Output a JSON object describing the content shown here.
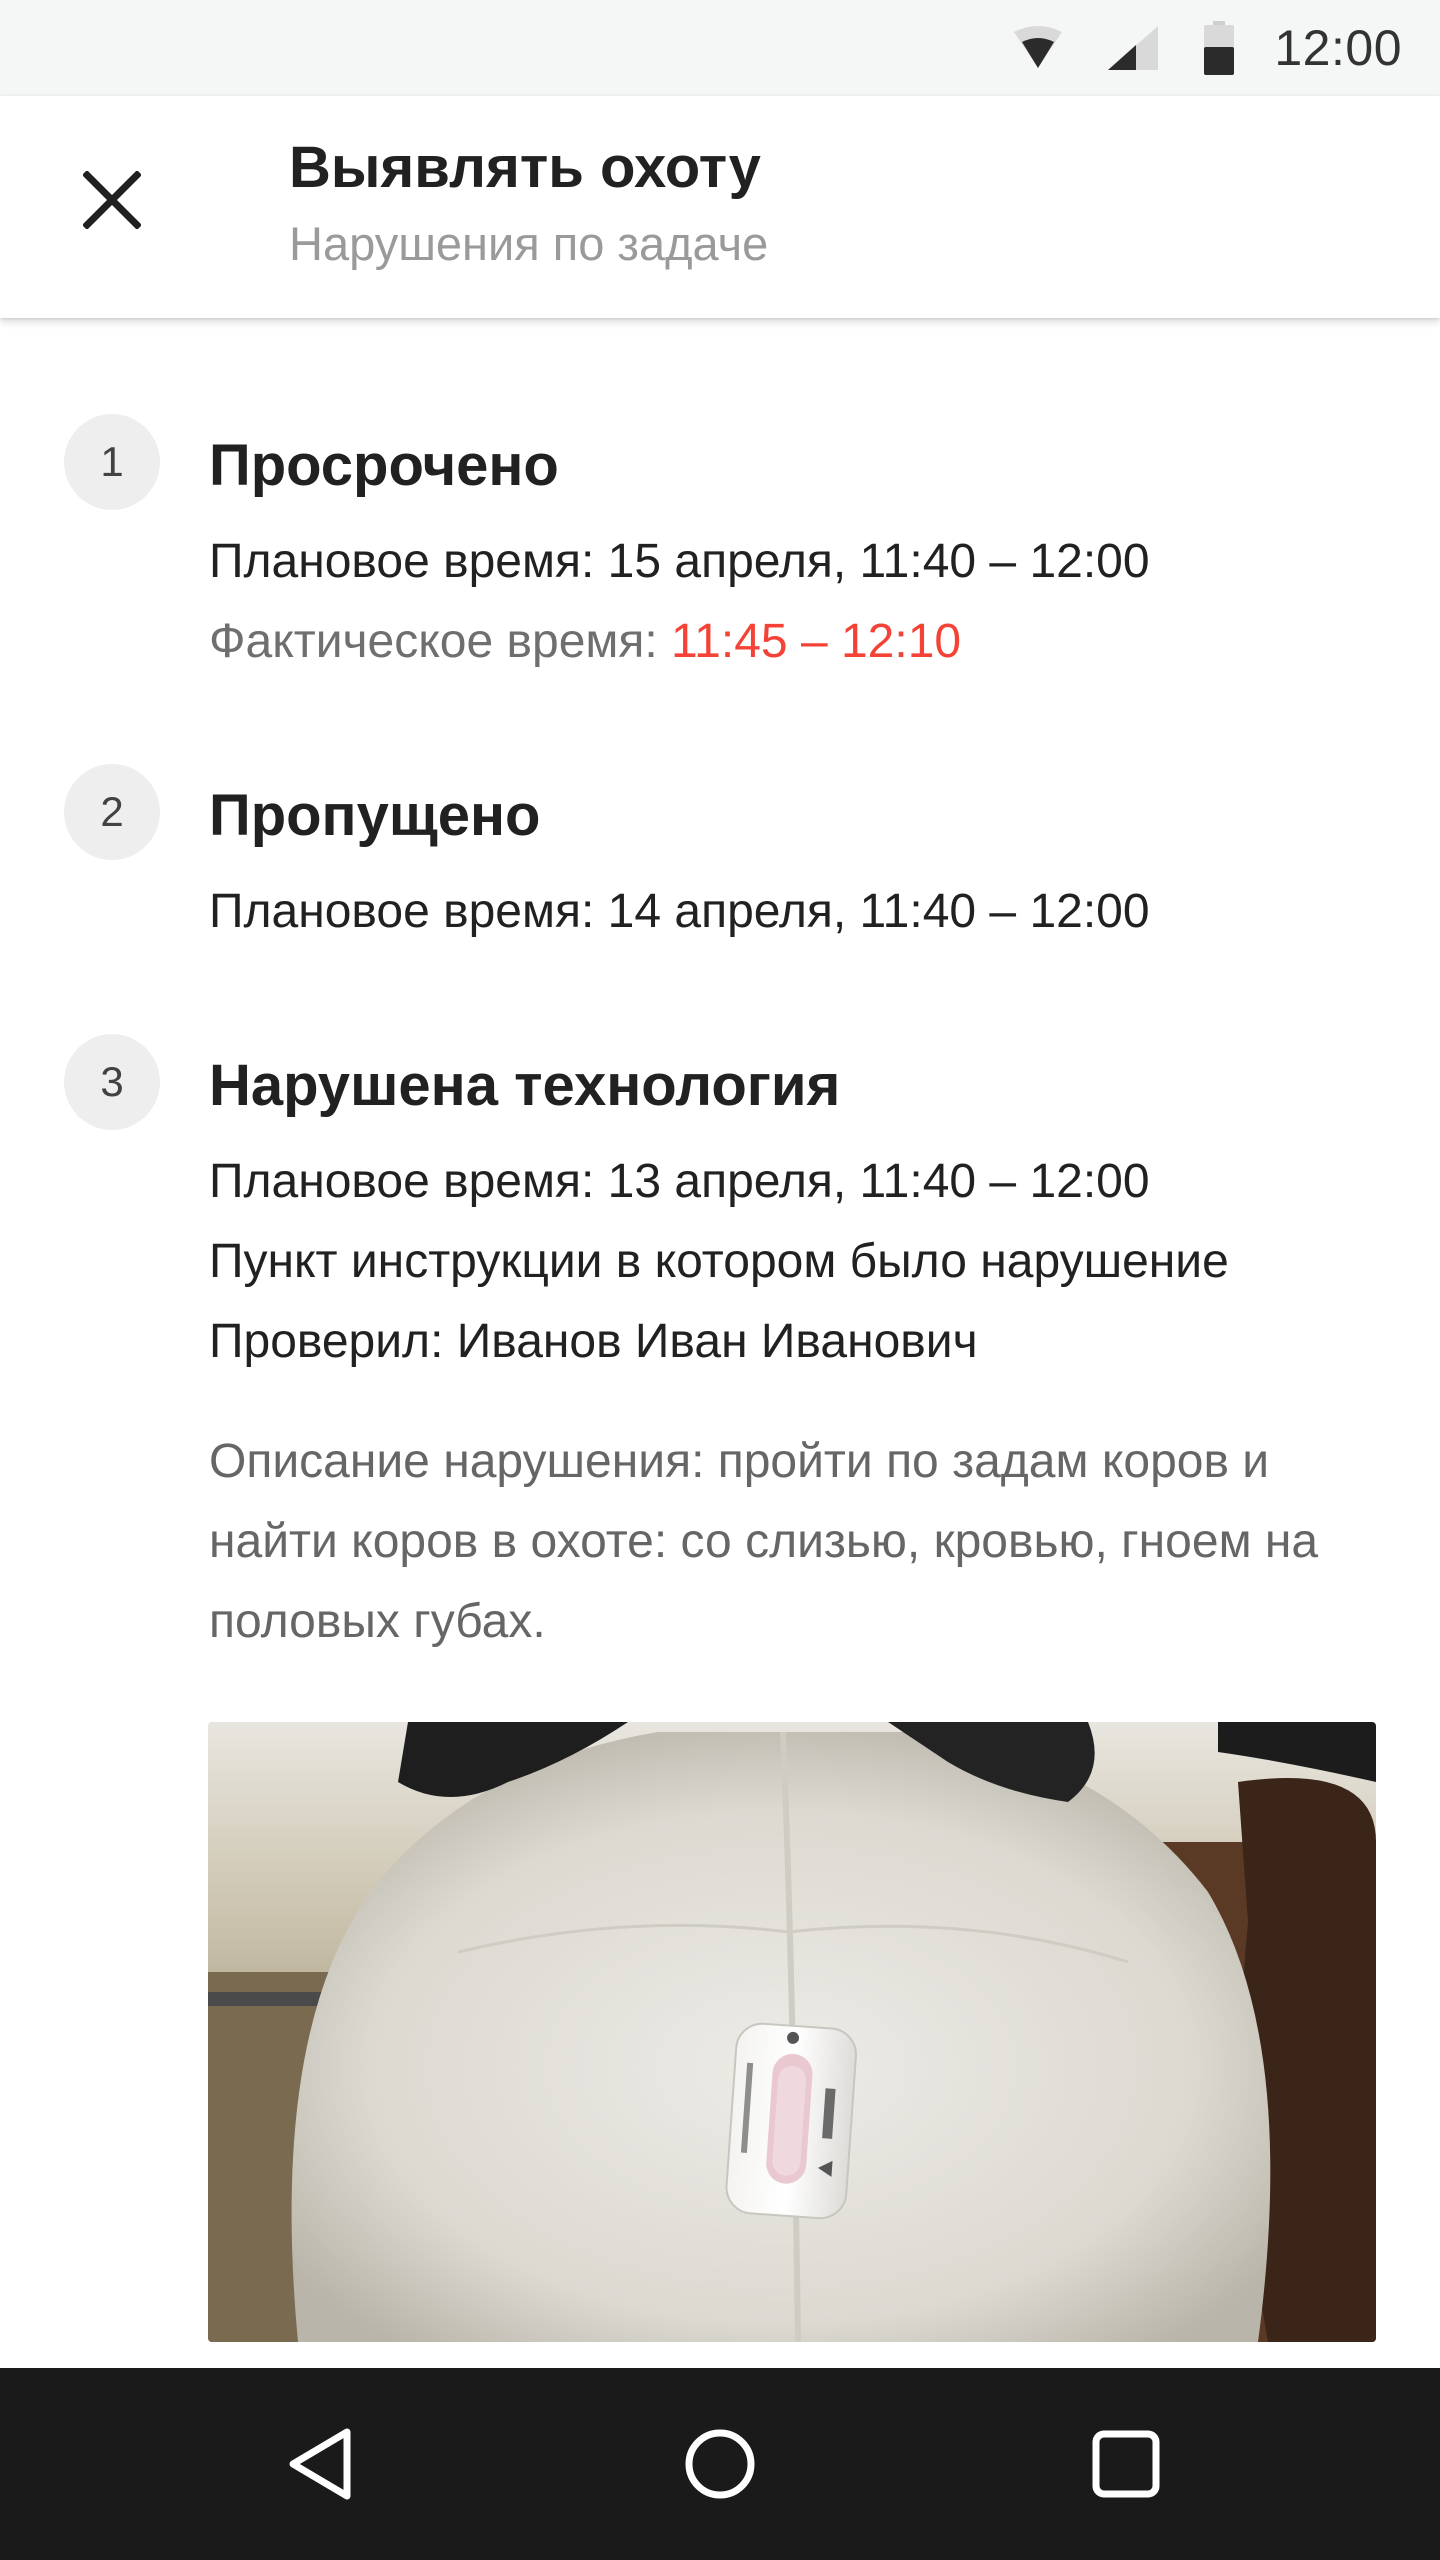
{
  "status_bar": {
    "time": "12:00",
    "icons": [
      "wifi-icon",
      "signal-icon",
      "battery-icon"
    ]
  },
  "app_bar": {
    "close_icon": "close-icon",
    "title": "Выявлять охоту",
    "subtitle": "Нарушения по задаче"
  },
  "violations": [
    {
      "number": "1",
      "title": "Просрочено",
      "planned_time": "Плановое время: 15 апреля, 11:40 – 12:00",
      "actual_label": "Фактическое время: ",
      "actual_value": "11:45 – 12:10"
    },
    {
      "number": "2",
      "title": "Пропущено",
      "planned_time": "Плановое время: 14 апреля, 11:40 – 12:00"
    },
    {
      "number": "3",
      "title": "Нарушена технология",
      "planned_time": "Плановое время: 13 апреля, 11:40 – 12:00",
      "instruction_point": "Пункт инструкции в котором было нарушение",
      "checked_by": "Проверил: Иванов Иван Иванович",
      "description": "Описание нарушения: пройти по задам коров и найти коров в охоте: со слизью, кровью, гноем на половых губах."
    }
  ],
  "nav_bar": {
    "buttons": [
      "back-icon",
      "home-icon",
      "recents-icon"
    ]
  },
  "colors": {
    "accent_red": "#f44336",
    "status_bar_bg": "#f5f6f6",
    "nav_bar_bg": "#1a1a1a",
    "number_badge_bg": "#eeeeee"
  }
}
